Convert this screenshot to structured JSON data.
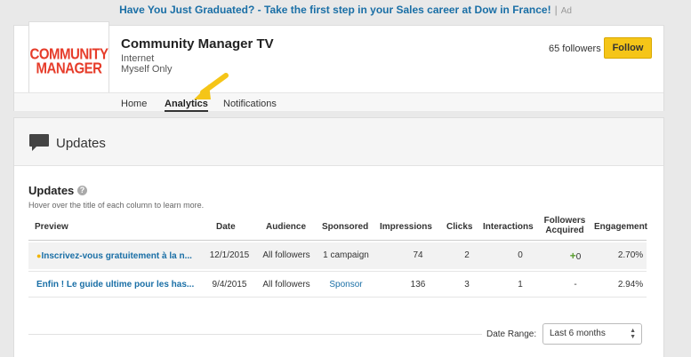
{
  "ad": {
    "headline": "Have You Just Graduated?",
    "rest": " - Take the first step in your Sales career at Dow in France!",
    "separator": "|",
    "tag": "Ad"
  },
  "company": {
    "logo_line1": "COMMUNITY",
    "logo_line2": "MANAGER",
    "name": "Community Manager TV",
    "industry": "Internet",
    "visibility": "Myself Only",
    "followers": "65 followers",
    "follow_label": "Follow"
  },
  "tabs": [
    {
      "label": "Home"
    },
    {
      "label": "Analytics"
    },
    {
      "label": "Notifications"
    }
  ],
  "updates_header": {
    "title": "Updates"
  },
  "updates": {
    "title": "Updates",
    "help": "?",
    "hint": "Hover over the title of each column to learn more.",
    "columns": [
      "Preview",
      "Date",
      "Audience",
      "Sponsored",
      "Impressions",
      "Clicks",
      "Interactions",
      "Followers",
      "Acquired",
      "Engagement"
    ],
    "rows": [
      {
        "preview": "Inscrivez-vous gratuitement à la n...",
        "date": "12/1/2015",
        "audience": "All followers",
        "sponsored": "1 campaign",
        "impressions": "74",
        "clicks": "2",
        "interactions": "0",
        "followers_acquired": "0",
        "engagement": "2.70%"
      },
      {
        "preview": "Enfin ! Le guide ultime pour les has...",
        "date": "9/4/2015",
        "audience": "All followers",
        "sponsored": "Sponsor",
        "impressions": "136",
        "clicks": "3",
        "interactions": "1",
        "followers_acquired": "-",
        "engagement": "2.94%"
      }
    ]
  },
  "date_range": {
    "label": "Date Range:",
    "selected": "Last 6 months"
  },
  "colors": {
    "accent": "#1a6fa6",
    "follow_button": "#f5c518",
    "logo": "#e63c2a",
    "arrow": "#f5c518"
  }
}
